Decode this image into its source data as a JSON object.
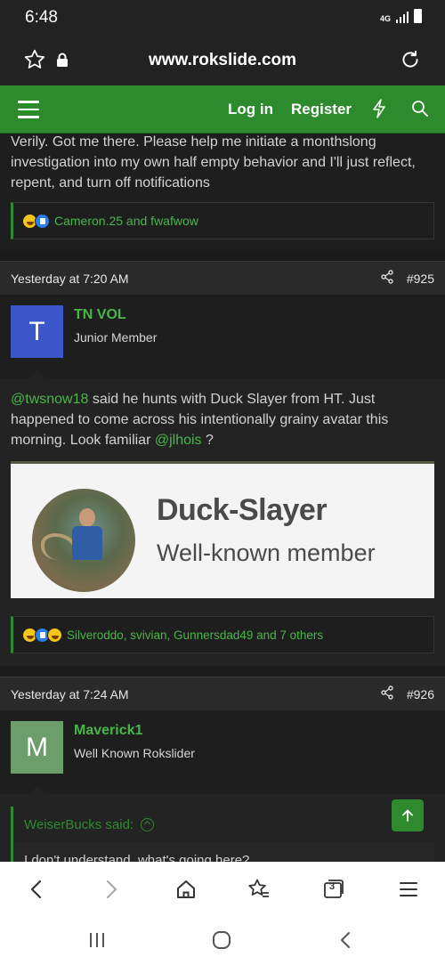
{
  "status_bar": {
    "time": "6:48",
    "network": "4G"
  },
  "browser": {
    "url": "www.rokslide.com"
  },
  "site_nav": {
    "login": "Log in",
    "register": "Register"
  },
  "post_prev": {
    "text": "Verily. Got me there. Please help me initiate a monthslong investigation into my own half empty behavior and I'll just reflect, repent, and turn off notifications",
    "reactions": "Cameron.25 and fwafwow"
  },
  "post_925": {
    "time": "Yesterday at 7:20 AM",
    "number": "#925",
    "avatar_letter": "T",
    "avatar_color": "#3b57c9",
    "username": "TN VOL",
    "user_title": "Junior Member",
    "mention1": "@twsnow18",
    "text1": " said he hunts with Duck Slayer from HT. Just happened to come across his intentionally grainy avatar this morning. Look familiar ",
    "mention2": "@jlhois",
    "text2": " ?",
    "embed_name": "Duck-Slayer",
    "embed_title": "Well-known member",
    "reactions": "Silveroddo, svivian, Gunnersdad49 and 7 others"
  },
  "post_926": {
    "time": "Yesterday at 7:24 AM",
    "number": "#926",
    "avatar_letter": "M",
    "avatar_color": "#6b9e6b",
    "username": "Maverick1",
    "user_title": "Well Known Rokslider",
    "quote_author": "WeiserBucks said:",
    "quote_text": "I don't understand, what's going here?"
  },
  "browser_toolbar": {
    "tab_count": "3"
  },
  "colors": {
    "accent": "#2d8a2d",
    "link": "#49b649",
    "page_bg": "#1b1b1b"
  }
}
